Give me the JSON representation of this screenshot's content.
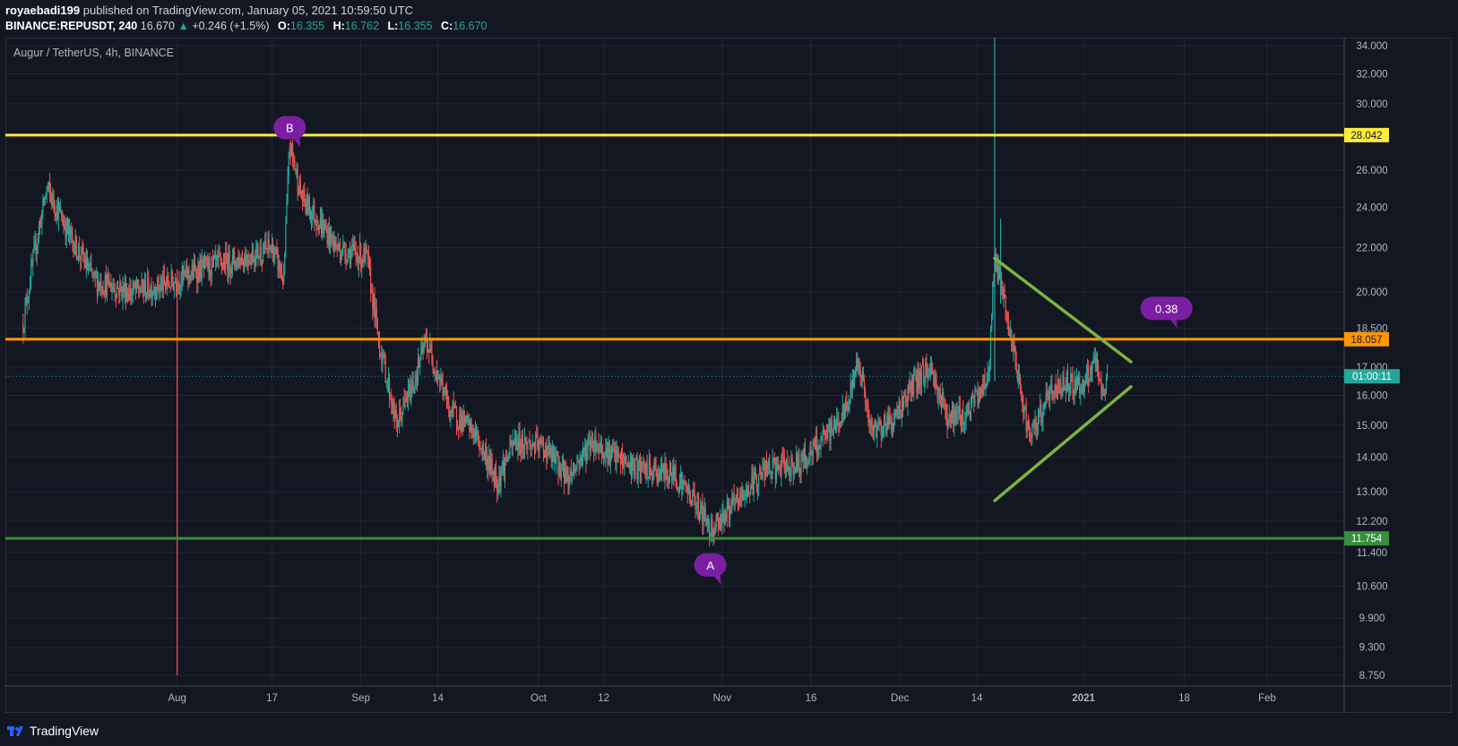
{
  "header": {
    "author": "royaebadi199",
    "published_text": "published on TradingView.com, January 05, 2021 10:59:50 UTC",
    "symbol_line": "BINANCE:REPUSDT, 240",
    "last_price": "16.670",
    "change_arrow": "▲",
    "change_text": "+0.246 (+1.5%)",
    "open_label": "O:",
    "open_value": "16.355",
    "high_label": "H:",
    "high_value": "16.762",
    "low_label": "L:",
    "low_value": "16.355",
    "close_label": "C:",
    "close_value": "16.670"
  },
  "footer": {
    "brand": "TradingView",
    "brand_icon": "tradingview-logo-icon"
  },
  "colors": {
    "background": "#131722",
    "grid": "#222633",
    "up": "#26a69a",
    "down": "#ef5350",
    "yellow_line": "#ffeb3b",
    "orange_line": "#ff9800",
    "green_line": "#388e3c",
    "triangle": "#7cb342",
    "marker": "#7b1fa2",
    "last_price": "#26a69a"
  },
  "chart_data": {
    "type": "candlestick",
    "title": "Augur / TetherUS, 4h, BINANCE",
    "x_ticks": [
      "Aug",
      "17",
      "Sep",
      "14",
      "Oct",
      "12",
      "Nov",
      "16",
      "Dec",
      "14",
      "2021",
      "18",
      "Feb"
    ],
    "y_ticks": [
      "34.000",
      "32.000",
      "30.000",
      "28.000",
      "26.000",
      "24.000",
      "22.000",
      "20.000",
      "18.500",
      "17.000",
      "16.000",
      "15.000",
      "14.000",
      "13.000",
      "12.200",
      "11.400",
      "10.600",
      "9.900",
      "9.300",
      "8.750"
    ],
    "y_scale": "log",
    "ylim": [
      8.55,
      34.6
    ],
    "grid": true,
    "horizontal_lines": [
      {
        "value": 28.042,
        "label": "28.042",
        "color": "#ffeb3b"
      },
      {
        "value": 18.057,
        "label": "18.057",
        "color": "#ff9800"
      },
      {
        "value": 11.754,
        "label": "11.754",
        "color": "#388e3c"
      }
    ],
    "last_price": {
      "value": 16.67,
      "countdown": "01:00:11"
    },
    "annotations": [
      {
        "text": "B",
        "date": "2020-08-20",
        "price": 28.5
      },
      {
        "text": "A",
        "date": "2020-10-30",
        "price": 11.1
      },
      {
        "text": "0.38",
        "date": "2021-01-15",
        "price": 19.3
      }
    ],
    "trendlines": [
      {
        "from": [
          "2020-12-17",
          21.5
        ],
        "to": [
          "2021-01-09",
          17.2
        ]
      },
      {
        "from": [
          "2020-12-17",
          12.75
        ],
        "to": [
          "2021-01-09",
          16.3
        ]
      }
    ],
    "series_anchors": [
      [
        "2020-07-06",
        18.7
      ],
      [
        "2020-07-10",
        25.0
      ],
      [
        "2020-07-14",
        22.5
      ],
      [
        "2020-07-18",
        20.5
      ],
      [
        "2020-07-24",
        20.0
      ],
      [
        "2020-07-30",
        20.3
      ],
      [
        "2020-08-05",
        21.0
      ],
      [
        "2020-08-12",
        21.5
      ],
      [
        "2020-08-17",
        22.0
      ],
      [
        "2020-08-19",
        20.5
      ],
      [
        "2020-08-20",
        27.5
      ],
      [
        "2020-08-22",
        24.5
      ],
      [
        "2020-08-28",
        22.0
      ],
      [
        "2020-09-02",
        21.5
      ],
      [
        "2020-09-04",
        18.0
      ],
      [
        "2020-09-07",
        15.0
      ],
      [
        "2020-09-10",
        16.5
      ],
      [
        "2020-09-12",
        18.0
      ],
      [
        "2020-09-16",
        15.5
      ],
      [
        "2020-09-20",
        14.8
      ],
      [
        "2020-09-24",
        13.3
      ],
      [
        "2020-09-27",
        14.5
      ],
      [
        "2020-10-02",
        14.3
      ],
      [
        "2020-10-06",
        13.4
      ],
      [
        "2020-10-10",
        14.5
      ],
      [
        "2020-10-14",
        14.0
      ],
      [
        "2020-10-18",
        13.6
      ],
      [
        "2020-10-24",
        13.5
      ],
      [
        "2020-10-28",
        12.6
      ],
      [
        "2020-10-30",
        12.0
      ],
      [
        "2020-11-04",
        12.8
      ],
      [
        "2020-11-08",
        13.6
      ],
      [
        "2020-11-14",
        13.8
      ],
      [
        "2020-11-18",
        14.5
      ],
      [
        "2020-11-22",
        15.5
      ],
      [
        "2020-11-24",
        17.4
      ],
      [
        "2020-11-26",
        14.8
      ],
      [
        "2020-11-30",
        15.2
      ],
      [
        "2020-12-03",
        16.3
      ],
      [
        "2020-12-06",
        17.0
      ],
      [
        "2020-12-09",
        15.3
      ],
      [
        "2020-12-12",
        15.3
      ],
      [
        "2020-12-15",
        16.3
      ],
      [
        "2020-12-16",
        16.8
      ],
      [
        "2020-12-17",
        21.5
      ],
      [
        "2020-12-19",
        19.0
      ],
      [
        "2020-12-21",
        16.5
      ],
      [
        "2020-12-23",
        14.5
      ],
      [
        "2020-12-26",
        16.0
      ],
      [
        "2020-12-29",
        16.5
      ],
      [
        "2021-01-01",
        16.3
      ],
      [
        "2021-01-03",
        17.2
      ],
      [
        "2021-01-04",
        16.0
      ],
      [
        "2021-01-05",
        16.67
      ]
    ],
    "spikes": [
      {
        "date": "2020-08-01",
        "low": 8.75,
        "high": 21.0
      },
      {
        "date": "2020-12-17",
        "low": 16.5,
        "high": 34.6
      },
      {
        "date": "2020-12-18",
        "low": 19.5,
        "high": 23.4
      }
    ]
  }
}
